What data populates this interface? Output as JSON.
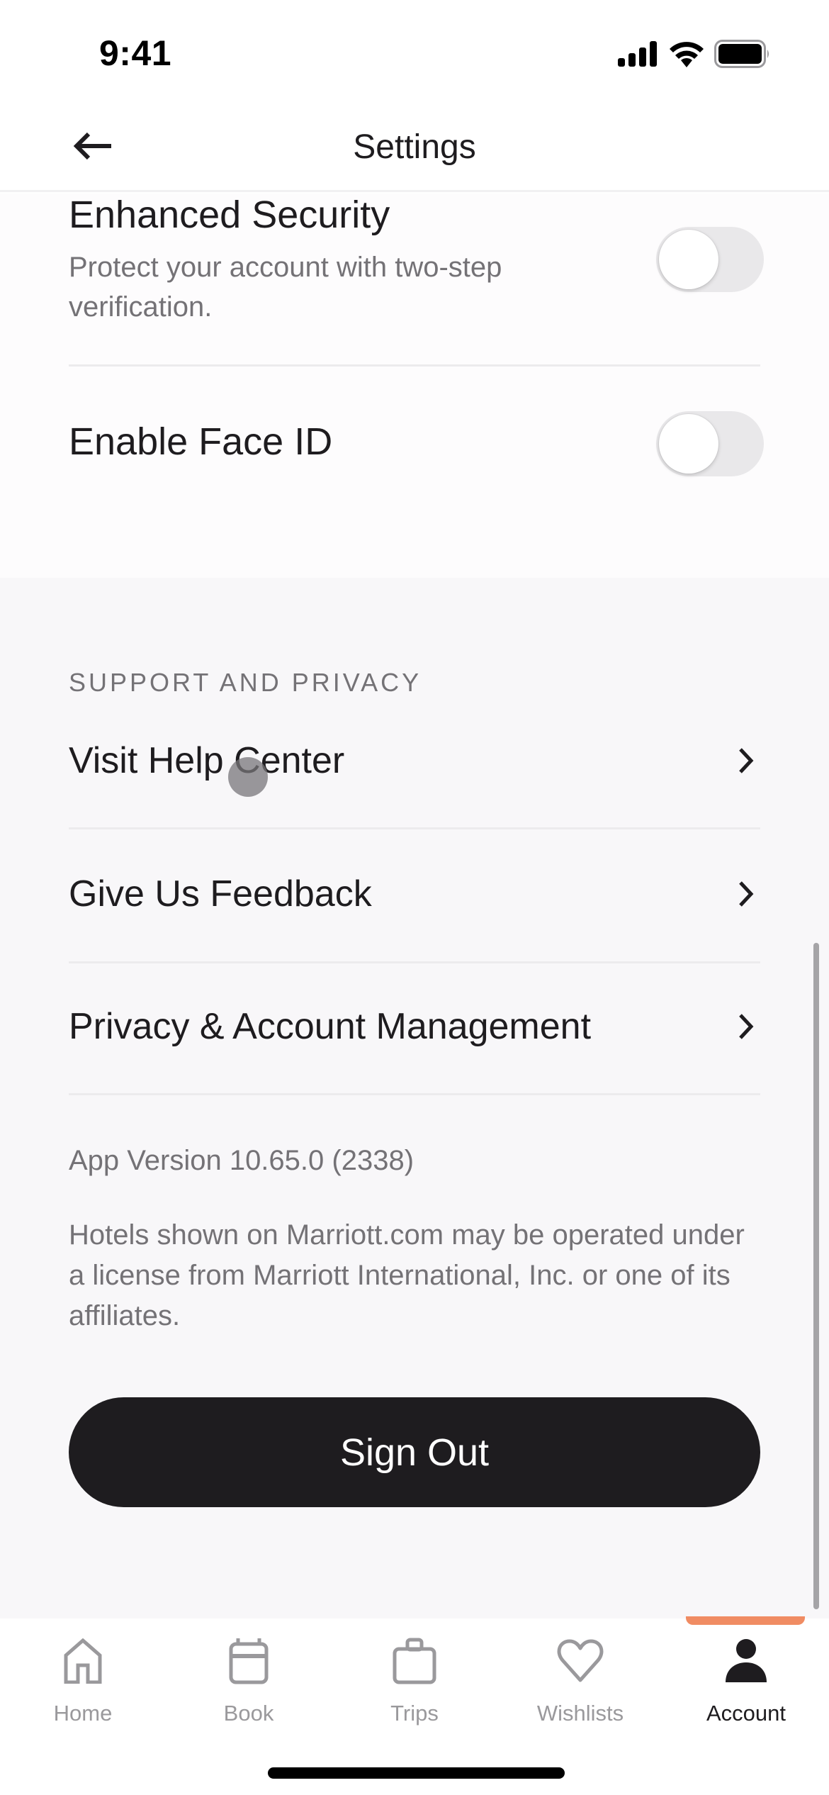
{
  "status_bar": {
    "time": "9:41",
    "icons": [
      "signal-icon",
      "wifi-icon",
      "battery-icon"
    ]
  },
  "header": {
    "title": "Settings",
    "back_icon": "arrow-left-icon"
  },
  "security": {
    "enhanced_security": {
      "title": "Enhanced Security",
      "subtitle": "Protect your account with two-step verification.",
      "enabled": false
    },
    "face_id": {
      "title": "Enable Face ID",
      "enabled": false
    }
  },
  "support": {
    "section_label": "SUPPORT AND PRIVACY",
    "items": [
      {
        "label": "Visit Help Center",
        "icon": "chevron-right-icon"
      },
      {
        "label": "Give Us Feedback",
        "icon": "chevron-right-icon"
      },
      {
        "label": "Privacy & Account Management",
        "icon": "chevron-right-icon"
      }
    ]
  },
  "footer": {
    "app_version": "App Version 10.65.0 (2338)",
    "disclaimer": "Hotels shown on Marriott.com may be operated under a license from Marriott International, Inc. or one of its affiliates.",
    "sign_out_label": "Sign Out"
  },
  "tab_bar": {
    "accent_color": "#f08c63",
    "active_index": 4,
    "tabs": [
      {
        "label": "Home",
        "icon": "home-icon"
      },
      {
        "label": "Book",
        "icon": "calendar-icon"
      },
      {
        "label": "Trips",
        "icon": "suitcase-icon"
      },
      {
        "label": "Wishlists",
        "icon": "heart-icon"
      },
      {
        "label": "Account",
        "icon": "person-icon"
      }
    ]
  }
}
